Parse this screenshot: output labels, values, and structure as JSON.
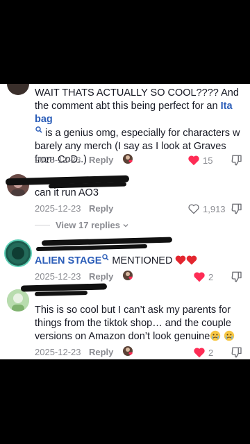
{
  "comments": [
    {
      "text_before": "WAIT THATS ACTUALLY SO COOL???? And the comment abt this being perfect for an ",
      "link": "Ita bag",
      "text_after": " is a genius omg, especially for characters w barely any merch (I say as I look at Graves from CoD..)",
      "date": "2025-12-23",
      "reply": "Reply",
      "likes": "15",
      "liked": true
    },
    {
      "text": "can it run AO3",
      "date": "2025-12-23",
      "reply": "Reply",
      "likes": "1,913",
      "liked": false,
      "view_replies": "View 17 replies"
    },
    {
      "link": "ALIEN STAGE",
      "text_after": " MENTIONED",
      "date": "2025-12-23",
      "reply": "Reply",
      "likes": "2",
      "liked": true
    },
    {
      "text": "This is so cool but I can’t ask my parents for things from the tiktok shop… and the couple versions on Amazon don’t look genuine",
      "date": "2025-12-23",
      "reply": "Reply",
      "likes": "2",
      "liked": true
    }
  ],
  "colors": {
    "heart": "#fe2c55",
    "link": "#2b5db8",
    "meta": "#8a8b91"
  }
}
